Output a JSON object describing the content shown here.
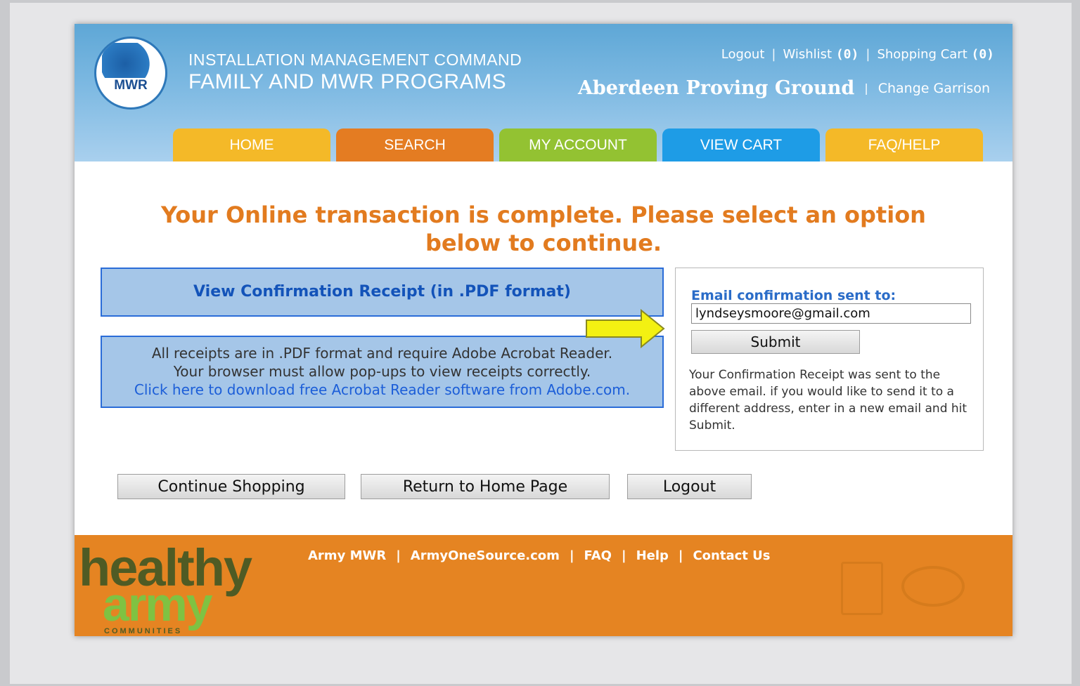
{
  "header": {
    "logo_text": "MWR",
    "org_line1": "INSTALLATION MANAGEMENT COMMAND",
    "org_line2": "FAMILY AND MWR PROGRAMS",
    "logout_label": "Logout",
    "wishlist_label": "Wishlist",
    "wishlist_count": "(0)",
    "cart_label": "Shopping Cart",
    "cart_count": "(0)",
    "separator": "|",
    "garrison_name": "Aberdeen Proving Ground",
    "change_garrison_label": "Change Garrison"
  },
  "tabs": [
    {
      "label": "HOME",
      "color": "#f4b928"
    },
    {
      "label": "SEARCH",
      "color": "#e47c22"
    },
    {
      "label": "MY ACCOUNT",
      "color": "#93c232"
    },
    {
      "label": "VIEW CART",
      "color": "#1e9ce6"
    },
    {
      "label": "FAQ/HELP",
      "color": "#f4b928"
    }
  ],
  "main": {
    "title_line1": "Your Online transaction is complete. Please select an option",
    "title_line2": "below to continue.",
    "view_receipt_label": "View Confirmation Receipt (in .PDF format)",
    "receipt_note_line1": "All receipts are in .PDF format and require Adobe Acrobat Reader.",
    "receipt_note_line2": "Your browser must allow pop-ups to view receipts correctly.",
    "download_link": "Click here to download free Acrobat Reader software from Adobe.com.",
    "email_label": "Email confirmation sent to:",
    "email_value": "lyndseysmoore@gmail.com",
    "submit_label": "Submit",
    "email_info": "Your Confirmation Receipt was sent to the above email. if you would like to send it to a different address, enter in a new email and hit Submit.",
    "continue_label": "Continue Shopping",
    "home_label": "Return to Home Page",
    "logout_label": "Logout"
  },
  "footer": {
    "brand_healthy": "healthy",
    "brand_army": "army",
    "brand_communities": "COMMUNITIES",
    "links": [
      "Army MWR",
      "ArmyOneSource.com",
      "FAQ",
      "Help",
      "Contact Us"
    ],
    "separator": "|"
  },
  "colors": {
    "accent_orange": "#e27b1f",
    "link_blue": "#1353b9",
    "box_blue": "#a5c6e8",
    "arrow_yellow": "#f3f112"
  }
}
